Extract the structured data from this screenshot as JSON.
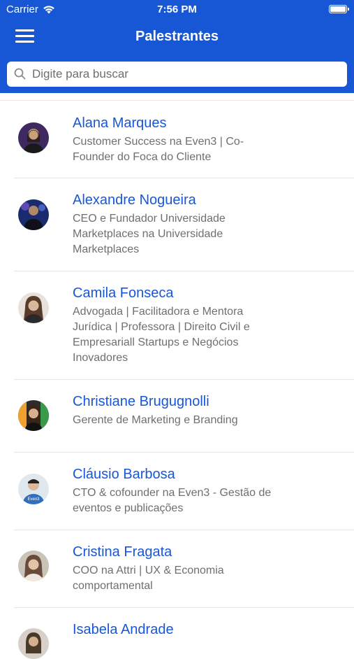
{
  "status_bar": {
    "carrier": "Carrier",
    "time": "7:56 PM"
  },
  "header": {
    "title": "Palestrantes",
    "menu_icon": "hamburger-menu-icon"
  },
  "search": {
    "placeholder": "Digite para buscar",
    "value": "",
    "icon": "search-icon"
  },
  "speakers": [
    {
      "name": "Alana Marques",
      "role": "Customer Success na Even3 | Co-Founder do Foca do Cliente",
      "avatar_colors": [
        "#3e2a60",
        "#c9a07a"
      ]
    },
    {
      "name": "Alexandre Nogueira",
      "role": "CEO e Fundador Universidade Marketplaces na Universidade Marketplaces",
      "avatar_colors": [
        "#1a2a6e",
        "#7a5ad0"
      ]
    },
    {
      "name": "Camila Fonseca",
      "role": "Advogada | Facilitadora e Mentora Jurídica | Professora | Direito Civil e Empresariall Startups e Negócios Inovadores",
      "avatar_colors": [
        "#5a3a2a",
        "#d8b89a"
      ]
    },
    {
      "name": "Christiane Brugugnolli",
      "role": "Gerente de Marketing e Branding",
      "avatar_colors": [
        "#2c2c2c",
        "#f0a030"
      ]
    },
    {
      "name": "Cláusio Barbosa",
      "role": "CTO & cofounder na Even3 - Gestão de eventos e publicações",
      "avatar_colors": [
        "#2f6fc0",
        "#d9b89c"
      ]
    },
    {
      "name": "Cristina Fragata",
      "role": "COO na Attri | UX & Economia comportamental",
      "avatar_colors": [
        "#6a4a3a",
        "#e2c3a8"
      ]
    },
    {
      "name": "Isabela Andrade",
      "role": "",
      "avatar_colors": [
        "#4a3a2a",
        "#d4b090"
      ]
    }
  ]
}
